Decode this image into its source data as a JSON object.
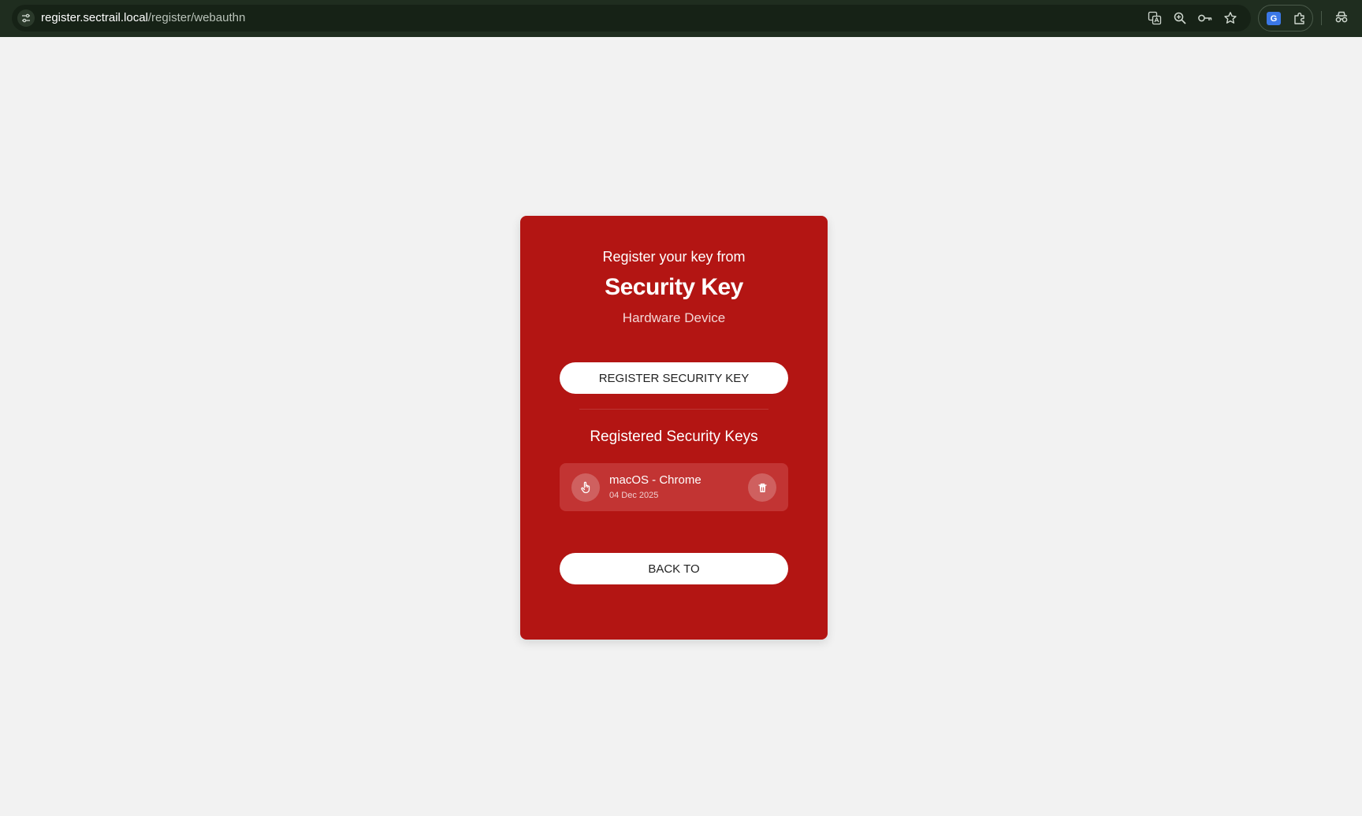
{
  "browser": {
    "url_host": "register.sectrail.local",
    "url_path": "/register/webauthn",
    "translate_badge": "G"
  },
  "card": {
    "eyebrow": "Register your key from",
    "title": "Security Key",
    "subtitle": "Hardware Device",
    "register_button_label": "REGISTER SECURITY KEY",
    "registered_keys_title": "Registered Security Keys",
    "keys": [
      {
        "name": "macOS - Chrome",
        "date": "04 Dec 2025",
        "icon": "pointer-hand-icon"
      }
    ],
    "back_button_label": "BACK TO"
  },
  "colors": {
    "page_background": "#f2f2f2",
    "card_background": "#b31513",
    "key_item_background": "#c23433",
    "button_background": "#ffffff",
    "browser_chrome": "#1f2d1f"
  }
}
